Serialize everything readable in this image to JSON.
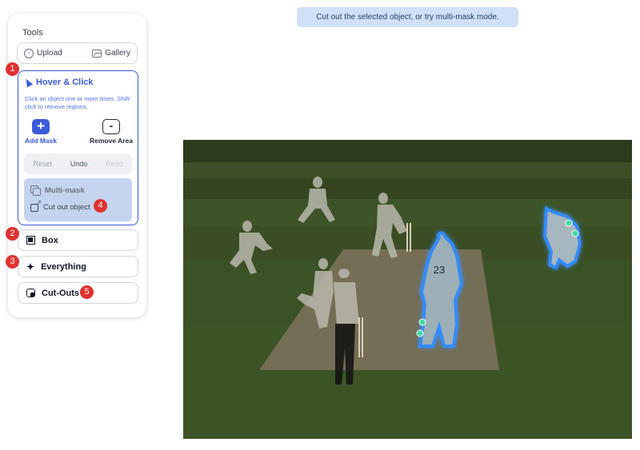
{
  "tooltip": "Cut out the selected object, or try multi-mask mode.",
  "sidebar": {
    "title": "Tools",
    "upload_label": "Upload",
    "gallery_label": "Gallery",
    "hover_panel": {
      "title": "Hover & Click",
      "description": "Click an object one or more times. Shift-click to remove regions.",
      "add_mask_label": "Add Mask",
      "remove_area_label": "Remove Area",
      "reset_label": "Reset",
      "undo_label": "Undo",
      "redo_label": "Redo",
      "multimask_label": "Multi-mask",
      "cutout_label": "Cut out object"
    },
    "box_label": "Box",
    "everything_label": "Everything",
    "cutouts_label": "Cut-Outs"
  },
  "badges": [
    "1",
    "2",
    "3",
    "4",
    "5"
  ],
  "image": {
    "jersey_number": "23"
  },
  "colors": {
    "accent": "#3b5bdb",
    "badge": "#e03131",
    "tooltip_bg": "#d0e1f7",
    "mask_glow": "#3aa0ff",
    "click_point": "#40d9a0"
  }
}
